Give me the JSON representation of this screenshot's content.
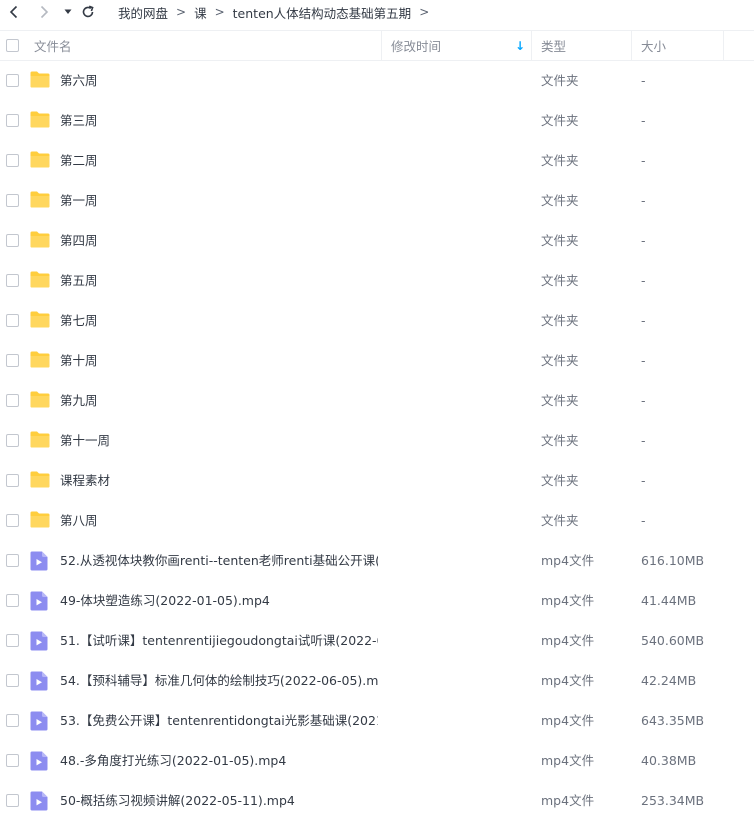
{
  "nav": {
    "breadcrumb": [
      "我的网盘",
      "课",
      "tenten人体结构动态基础第五期"
    ],
    "separator": ">"
  },
  "header": {
    "col_name": "文件名",
    "col_modified": "修改时间",
    "col_type": "类型",
    "col_size": "大小",
    "sort_indicator": "↓"
  },
  "colors": {
    "accent": "#06a7ff",
    "folder": "#ffce3d",
    "video": "#8c8cf0"
  },
  "files": [
    {
      "name": "第六周",
      "type": "文件夹",
      "size": "-",
      "kind": "folder"
    },
    {
      "name": "第三周",
      "type": "文件夹",
      "size": "-",
      "kind": "folder"
    },
    {
      "name": "第二周",
      "type": "文件夹",
      "size": "-",
      "kind": "folder"
    },
    {
      "name": "第一周",
      "type": "文件夹",
      "size": "-",
      "kind": "folder"
    },
    {
      "name": "第四周",
      "type": "文件夹",
      "size": "-",
      "kind": "folder"
    },
    {
      "name": "第五周",
      "type": "文件夹",
      "size": "-",
      "kind": "folder"
    },
    {
      "name": "第七周",
      "type": "文件夹",
      "size": "-",
      "kind": "folder"
    },
    {
      "name": "第十周",
      "type": "文件夹",
      "size": "-",
      "kind": "folder"
    },
    {
      "name": "第九周",
      "type": "文件夹",
      "size": "-",
      "kind": "folder"
    },
    {
      "name": "第十一周",
      "type": "文件夹",
      "size": "-",
      "kind": "folder"
    },
    {
      "name": "课程素材",
      "type": "文件夹",
      "size": "-",
      "kind": "folder"
    },
    {
      "name": "第八周",
      "type": "文件夹",
      "size": "-",
      "kind": "folder"
    },
    {
      "name": "52.从透视体块教你画renti--tenten老师renti基础公开课(...",
      "type": "mp4文件",
      "size": "616.10MB",
      "kind": "video"
    },
    {
      "name": "49-体块塑造练习(2022-01-05).mp4",
      "type": "mp4文件",
      "size": "41.44MB",
      "kind": "video"
    },
    {
      "name": "51.【试听课】tentenrentijiegoudongtai试听课(2022-0...",
      "type": "mp4文件",
      "size": "540.60MB",
      "kind": "video"
    },
    {
      "name": "54.【预科辅导】标准几何体的绘制技巧(2022-06-05).mp4",
      "type": "mp4文件",
      "size": "42.24MB",
      "kind": "video"
    },
    {
      "name": "53.【免费公开课】tentenrentidongtai光影基础课(2021...",
      "type": "mp4文件",
      "size": "643.35MB",
      "kind": "video"
    },
    {
      "name": "48.-多角度打光练习(2022-01-05).mp4",
      "type": "mp4文件",
      "size": "40.38MB",
      "kind": "video"
    },
    {
      "name": "50-概括练习视频讲解(2022-05-11).mp4",
      "type": "mp4文件",
      "size": "253.34MB",
      "kind": "video"
    }
  ]
}
